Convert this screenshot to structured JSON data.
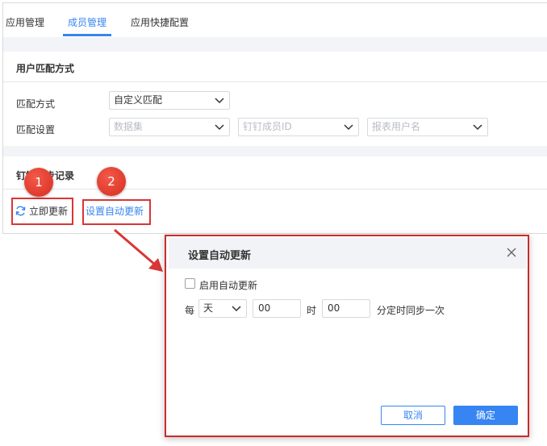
{
  "tabs": [
    {
      "label": "应用管理",
      "active": false
    },
    {
      "label": "成员管理",
      "active": true
    },
    {
      "label": "应用快捷配置",
      "active": false
    }
  ],
  "match_section": {
    "title": "用户匹配方式",
    "method_label": "匹配方式",
    "method_value": "自定义匹配",
    "settings_label": "匹配设置",
    "settings_selects": [
      {
        "placeholder": "数据集"
      },
      {
        "placeholder": "钉钉成员ID"
      },
      {
        "placeholder": "报表用户名"
      }
    ]
  },
  "record_section": {
    "title": "钉钉同步记录",
    "refresh_label": "立即更新",
    "auto_update_label": "设置自动更新"
  },
  "badges": [
    "1",
    "2"
  ],
  "dialog": {
    "title": "设置自动更新",
    "enable_label": "启用自动更新",
    "enabled": false,
    "every_label": "每",
    "period_value": "天",
    "hour_value": "00",
    "hour_label": "时",
    "minute_value": "00",
    "minute_suffix": "分定时同步一次",
    "cancel_label": "取消",
    "ok_label": "确定"
  },
  "colors": {
    "accent": "#3685f2",
    "annotation_red": "#d93636",
    "band": "#f2f4f7"
  },
  "icons": {
    "refresh": "refresh-icon",
    "close": "close-icon",
    "dropdown": "chevron-down-icon"
  }
}
